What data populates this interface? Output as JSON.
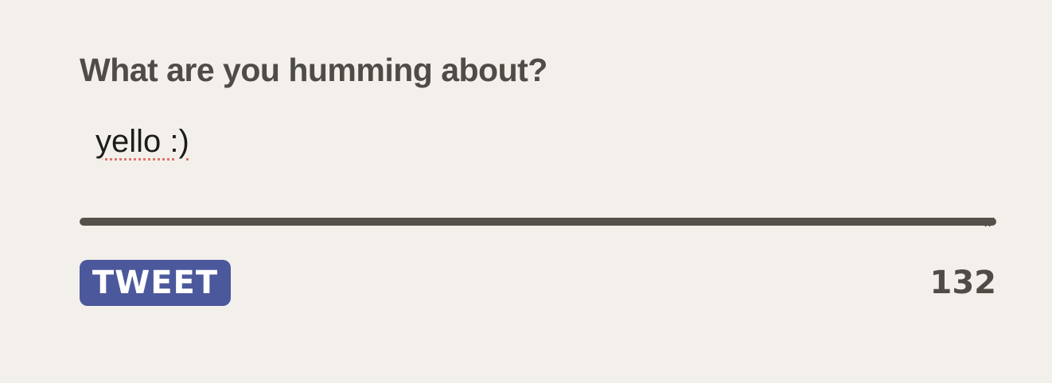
{
  "composer": {
    "prompt": "What are you humming about?",
    "field_value": "yello :)",
    "tweet_label": "TWEET",
    "remaining_count": "132"
  },
  "colors": {
    "background": "#f3f0eb",
    "text": "#4f4b46",
    "underline": "#555049",
    "button": "#4b589c",
    "spellcheck": "#e0736a"
  }
}
